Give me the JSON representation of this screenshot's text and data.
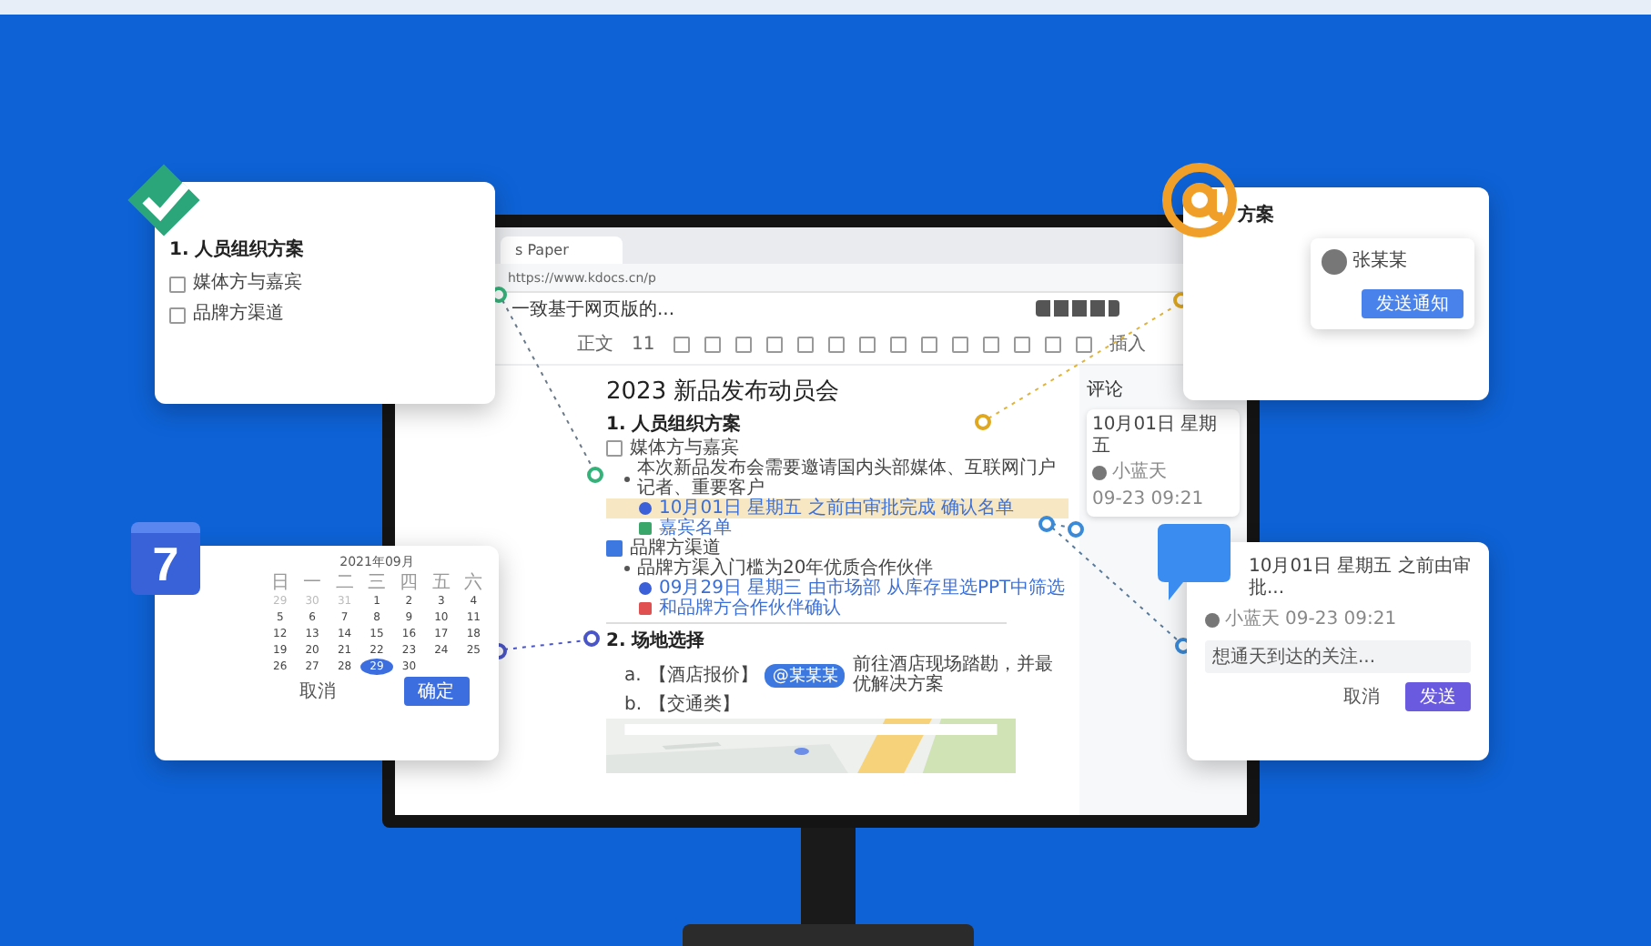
{
  "browser": {
    "tab": "s Paper",
    "url": "https://www.kdocs.cn/p",
    "doc_name": "一致基于网页版的...",
    "toolbar": {
      "style": "正文",
      "size": "11",
      "insert": "插入"
    }
  },
  "document": {
    "title": "2023 新品发布动员会",
    "sections": [
      {
        "heading": "1. 人员组织方案",
        "items": [
          {
            "kind": "task",
            "text": "媒体方与嘉宾",
            "checked": false
          },
          {
            "kind": "bullet",
            "text": "本次新品发布会需要邀请国内头部媒体、互联网门户记者、重要客户"
          },
          {
            "kind": "date",
            "text": "10月01日 星期五 之前由审批完成 确认名单",
            "highlighted": true
          },
          {
            "kind": "sheet",
            "text": "嘉宾名单"
          },
          {
            "kind": "task",
            "text": "品牌方渠道",
            "checked": true
          },
          {
            "kind": "bullet",
            "text": "品牌方渠入门槛为20年优质合作伙伴"
          },
          {
            "kind": "date",
            "text": "09月29日 星期三 由市场部 从库存里选PPT中筛选",
            "highlighted": false
          },
          {
            "kind": "file",
            "text": "和品牌方合作伙伴确认"
          }
        ]
      },
      {
        "heading": "2. 场地选择",
        "items": [
          {
            "kind": "lettered",
            "marker": "a.",
            "text": "【酒店报价】",
            "tag": "@某某某",
            "after": "前往酒店现场踏勘，并最优解决方案"
          },
          {
            "kind": "lettered",
            "marker": "b.",
            "text": "【交通类】"
          },
          {
            "kind": "picture"
          }
        ]
      }
    ]
  },
  "comments": {
    "title": "评论",
    "items": [
      {
        "quote": "10月01日 星期五",
        "author": "小蓝天",
        "time": "09-23 09:21"
      }
    ]
  },
  "cards": [
    {
      "kind": "tasks",
      "heading": "1. 人员组织方案",
      "lines": [
        {
          "text": "媒体方与嘉宾",
          "checked": false
        },
        {
          "text": "品牌方渠道",
          "checked": false
        }
      ]
    },
    {
      "kind": "calendar",
      "month": "2021年09月",
      "weekdays": [
        "日",
        "一",
        "二",
        "三",
        "四",
        "五",
        "六"
      ],
      "days": [
        {
          "label": "29",
          "outside": true,
          "selected": false
        },
        {
          "label": "30",
          "outside": true,
          "selected": false
        },
        {
          "label": "31",
          "outside": true,
          "selected": false
        },
        {
          "label": "1",
          "outside": false,
          "selected": false
        },
        {
          "label": "2",
          "outside": false,
          "selected": false
        },
        {
          "label": "3",
          "outside": false,
          "selected": false
        },
        {
          "label": "4",
          "outside": false,
          "selected": false
        },
        {
          "label": "5",
          "outside": false,
          "selected": false
        },
        {
          "label": "6",
          "outside": false,
          "selected": false
        },
        {
          "label": "7",
          "outside": false,
          "selected": false
        },
        {
          "label": "8",
          "outside": false,
          "selected": false
        },
        {
          "label": "9",
          "outside": false,
          "selected": false
        },
        {
          "label": "10",
          "outside": false,
          "selected": false
        },
        {
          "label": "11",
          "outside": false,
          "selected": false
        },
        {
          "label": "12",
          "outside": false,
          "selected": false
        },
        {
          "label": "13",
          "outside": false,
          "selected": false
        },
        {
          "label": "14",
          "outside": false,
          "selected": false
        },
        {
          "label": "15",
          "outside": false,
          "selected": false
        },
        {
          "label": "16",
          "outside": false,
          "selected": false
        },
        {
          "label": "17",
          "outside": false,
          "selected": false
        },
        {
          "label": "18",
          "outside": false,
          "selected": false
        },
        {
          "label": "19",
          "outside": false,
          "selected": false
        },
        {
          "label": "20",
          "outside": false,
          "selected": false
        },
        {
          "label": "21",
          "outside": false,
          "selected": false
        },
        {
          "label": "22",
          "outside": false,
          "selected": false
        },
        {
          "label": "23",
          "outside": false,
          "selected": false
        },
        {
          "label": "24",
          "outside": false,
          "selected": false
        },
        {
          "label": "25",
          "outside": false,
          "selected": false
        },
        {
          "label": "26",
          "outside": false,
          "selected": false
        },
        {
          "label": "27",
          "outside": false,
          "selected": false
        },
        {
          "label": "28",
          "outside": false,
          "selected": false
        },
        {
          "label": "29",
          "outside": false,
          "selected": true
        },
        {
          "label": "30",
          "outside": false,
          "selected": false
        }
      ],
      "icon_number": "7",
      "buttons": [
        "取消",
        "确定"
      ]
    },
    {
      "kind": "mention",
      "heading": "方案",
      "person": "张某某",
      "button": "发送通知"
    },
    {
      "kind": "comment",
      "quote": "10月01日 星期五 之前由审批...",
      "author": "小蓝天",
      "time": "09-23 09:21",
      "input": "想通天到达的关注...",
      "buttons": [
        "取消",
        "发送"
      ]
    }
  ]
}
